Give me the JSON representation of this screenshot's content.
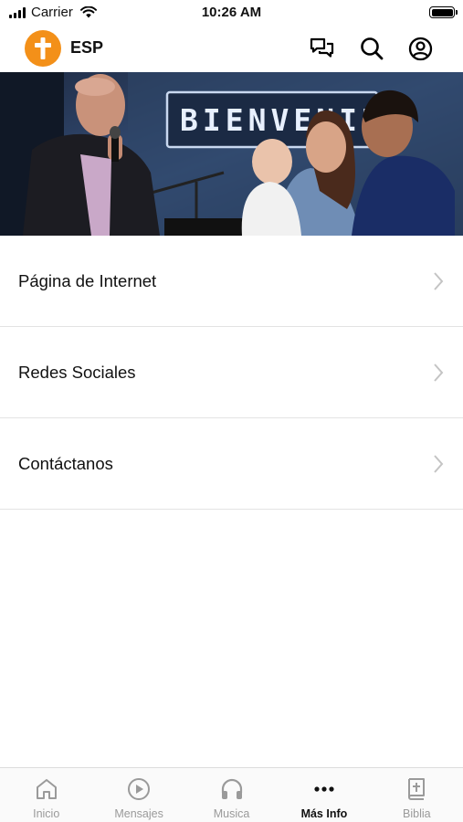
{
  "status_bar": {
    "carrier": "Carrier",
    "time": "10:26 AM"
  },
  "header": {
    "title": "ESP"
  },
  "hero": {
    "banner_text": "BIENVENID"
  },
  "menu": {
    "items": [
      {
        "label": "Página de Internet"
      },
      {
        "label": "Redes Sociales"
      },
      {
        "label": "Contáctanos"
      }
    ]
  },
  "tabbar": {
    "tabs": [
      {
        "label": "Inicio",
        "icon": "home-icon"
      },
      {
        "label": "Mensajes",
        "icon": "play-circle-icon"
      },
      {
        "label": "Musica",
        "icon": "headphones-icon"
      },
      {
        "label": "Más Info",
        "icon": "more-icon",
        "active": true
      },
      {
        "label": "Biblia",
        "icon": "bible-icon"
      }
    ]
  },
  "colors": {
    "brand": "#f39019",
    "text": "#111111",
    "inactive_tab": "#9a9a9a",
    "divider": "#e3e3e3"
  }
}
